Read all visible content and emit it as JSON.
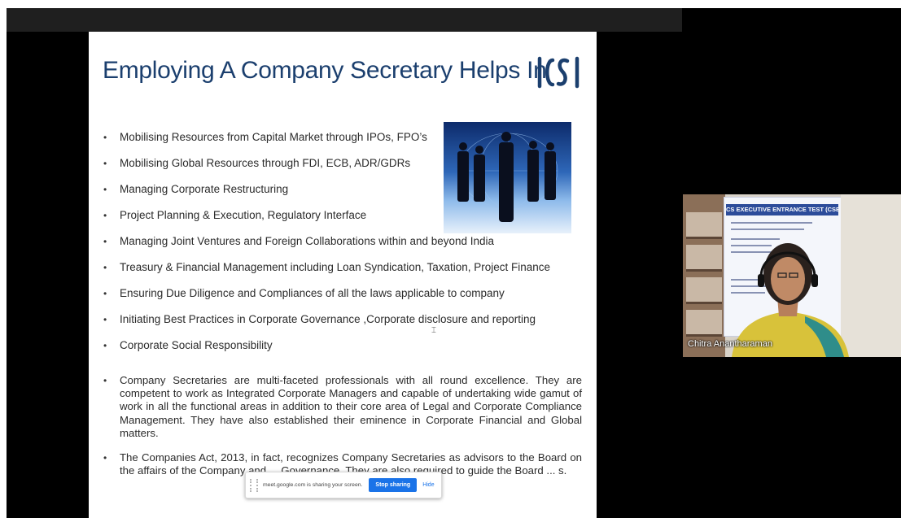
{
  "slide": {
    "title": "Employing A Company Secretary Helps In",
    "logo_text": "ICSI",
    "bullets": [
      "Mobilising Resources from Capital Market through IPOs, FPO’s",
      "Mobilising Global Resources through FDI, ECB, ADR/GDRs",
      "Managing Corporate Restructuring",
      "Project Planning & Execution, Regulatory Interface",
      "Managing Joint Ventures and Foreign Collaborations within and beyond India",
      "Treasury & Financial Management including Loan Syndication, Taxation, Project Finance",
      "Ensuring Due Diligence and  Compliances of all the laws applicable to company",
      "Initiating Best Practices in Corporate Governance ,Corporate disclosure and reporting",
      "Corporate Social Responsibility"
    ],
    "paragraph1": "Company Secretaries are multi-faceted professionals with all round excellence. They are competent to work as Integrated Corporate Managers and capable of undertaking wide gamut of work in all the functional areas in addition to their core area of Legal and Corporate Compliance Management. They have also established their eminence in Corporate Financial and Global matters.",
    "paragraph2": "The Companies Act, 2013, in fact, recognizes Company Secretaries as advisors to the Board on the affairs of the Company and ... Governance. They are also required to guide the Board ... s.",
    "bullet_glyph": "•"
  },
  "share_bar": {
    "text": "meet.google.com is sharing your screen.",
    "stop_label": "Stop sharing",
    "hide_label": "Hide"
  },
  "video": {
    "participant_name": "Chitra Anantharaman",
    "poster_heading": "CS EXECUTIVE ENTRANCE TEST (CSEET)"
  },
  "colors": {
    "title": "#1b3f6e",
    "logo": "#1b3f6e",
    "stop_button": "#1a73e8"
  }
}
